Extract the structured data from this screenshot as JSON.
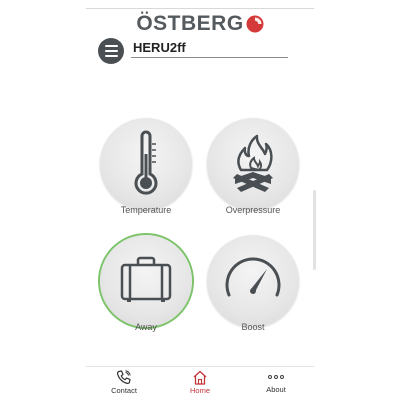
{
  "header": {
    "brand": "ÖSTBERG",
    "brand_accent_color": "#d43a3a",
    "device_name": "HERU2ff",
    "menu_icon": "hamburger-menu-icon"
  },
  "modes": [
    {
      "label": "Temperature",
      "icon": "thermometer-icon",
      "selected": false
    },
    {
      "label": "Overpressure",
      "icon": "fire-icon",
      "selected": false
    },
    {
      "label": "Away",
      "icon": "suitcase-icon",
      "selected": true
    },
    {
      "label": "Boost",
      "icon": "gauge-icon",
      "selected": false
    }
  ],
  "selected_ring_color": "#7cc36a",
  "nav": {
    "items": [
      {
        "label": "Contact",
        "icon": "phone-icon",
        "active": false
      },
      {
        "label": "Home",
        "icon": "home-icon",
        "active": true
      },
      {
        "label": "About",
        "icon": "more-dots-icon",
        "active": false
      }
    ],
    "active_color": "#c4343b"
  }
}
